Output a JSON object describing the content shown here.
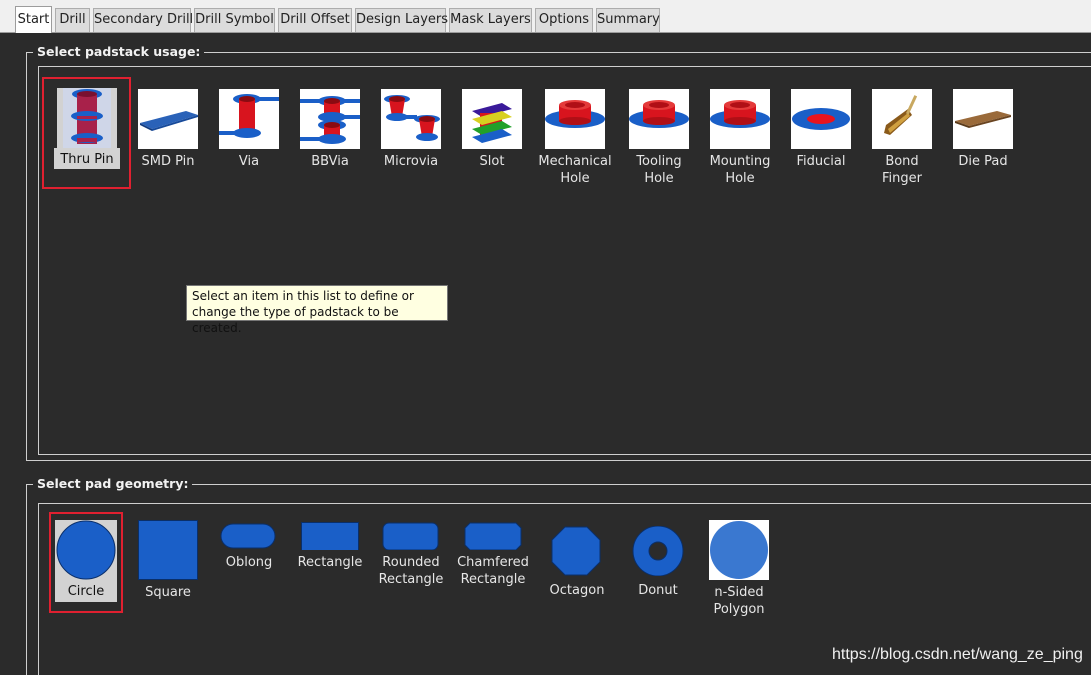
{
  "tabs": [
    {
      "label": "Start",
      "active": true
    },
    {
      "label": "Drill"
    },
    {
      "label": "Secondary Drill"
    },
    {
      "label": "Drill Symbol"
    },
    {
      "label": "Drill Offset"
    },
    {
      "label": "Design Layers"
    },
    {
      "label": "Mask Layers"
    },
    {
      "label": "Options"
    },
    {
      "label": "Summary"
    }
  ],
  "usage": {
    "title": "Select padstack usage:",
    "selected": "Thru Pin",
    "items": [
      {
        "label": "Thru Pin",
        "icon": "thru-pin-icon"
      },
      {
        "label": "SMD Pin",
        "icon": "smd-pin-icon"
      },
      {
        "label": "Via",
        "icon": "via-icon"
      },
      {
        "label": "BBVia",
        "icon": "bbvia-icon"
      },
      {
        "label": "Microvia",
        "icon": "microvia-icon"
      },
      {
        "label": "Slot",
        "icon": "slot-icon"
      },
      {
        "label": "Mechanical\nHole",
        "icon": "mechanical-hole-icon"
      },
      {
        "label": "Tooling\nHole",
        "icon": "tooling-hole-icon"
      },
      {
        "label": "Mounting\nHole",
        "icon": "mounting-hole-icon"
      },
      {
        "label": "Fiducial",
        "icon": "fiducial-icon"
      },
      {
        "label": "Bond\nFinger",
        "icon": "bond-finger-icon"
      },
      {
        "label": "Die Pad",
        "icon": "die-pad-icon"
      }
    ],
    "tooltip": "Select an item in this list to define or change the type of padstack to be created."
  },
  "geometry": {
    "title": "Select pad geometry:",
    "selected": "Circle",
    "items": [
      {
        "label": "Circle",
        "icon": "circle-icon"
      },
      {
        "label": "Square",
        "icon": "square-icon"
      },
      {
        "label": "Oblong",
        "icon": "oblong-icon"
      },
      {
        "label": "Rectangle",
        "icon": "rectangle-icon"
      },
      {
        "label": "Rounded\nRectangle",
        "icon": "rounded-rectangle-icon"
      },
      {
        "label": "Chamfered\nRectangle",
        "icon": "chamfered-rectangle-icon"
      },
      {
        "label": "Octagon",
        "icon": "octagon-icon"
      },
      {
        "label": "Donut",
        "icon": "donut-icon"
      },
      {
        "label": "n-Sided\nPolygon",
        "icon": "n-sided-polygon-icon"
      }
    ]
  },
  "watermark": "https://blog.csdn.net/wang_ze_ping",
  "colors": {
    "pad_blue": "#1a5fc8",
    "barrel_red": "#d8141e",
    "selection_red": "#e02030",
    "background": "#2b2b2b",
    "tooltip_bg": "#ffffe1"
  }
}
